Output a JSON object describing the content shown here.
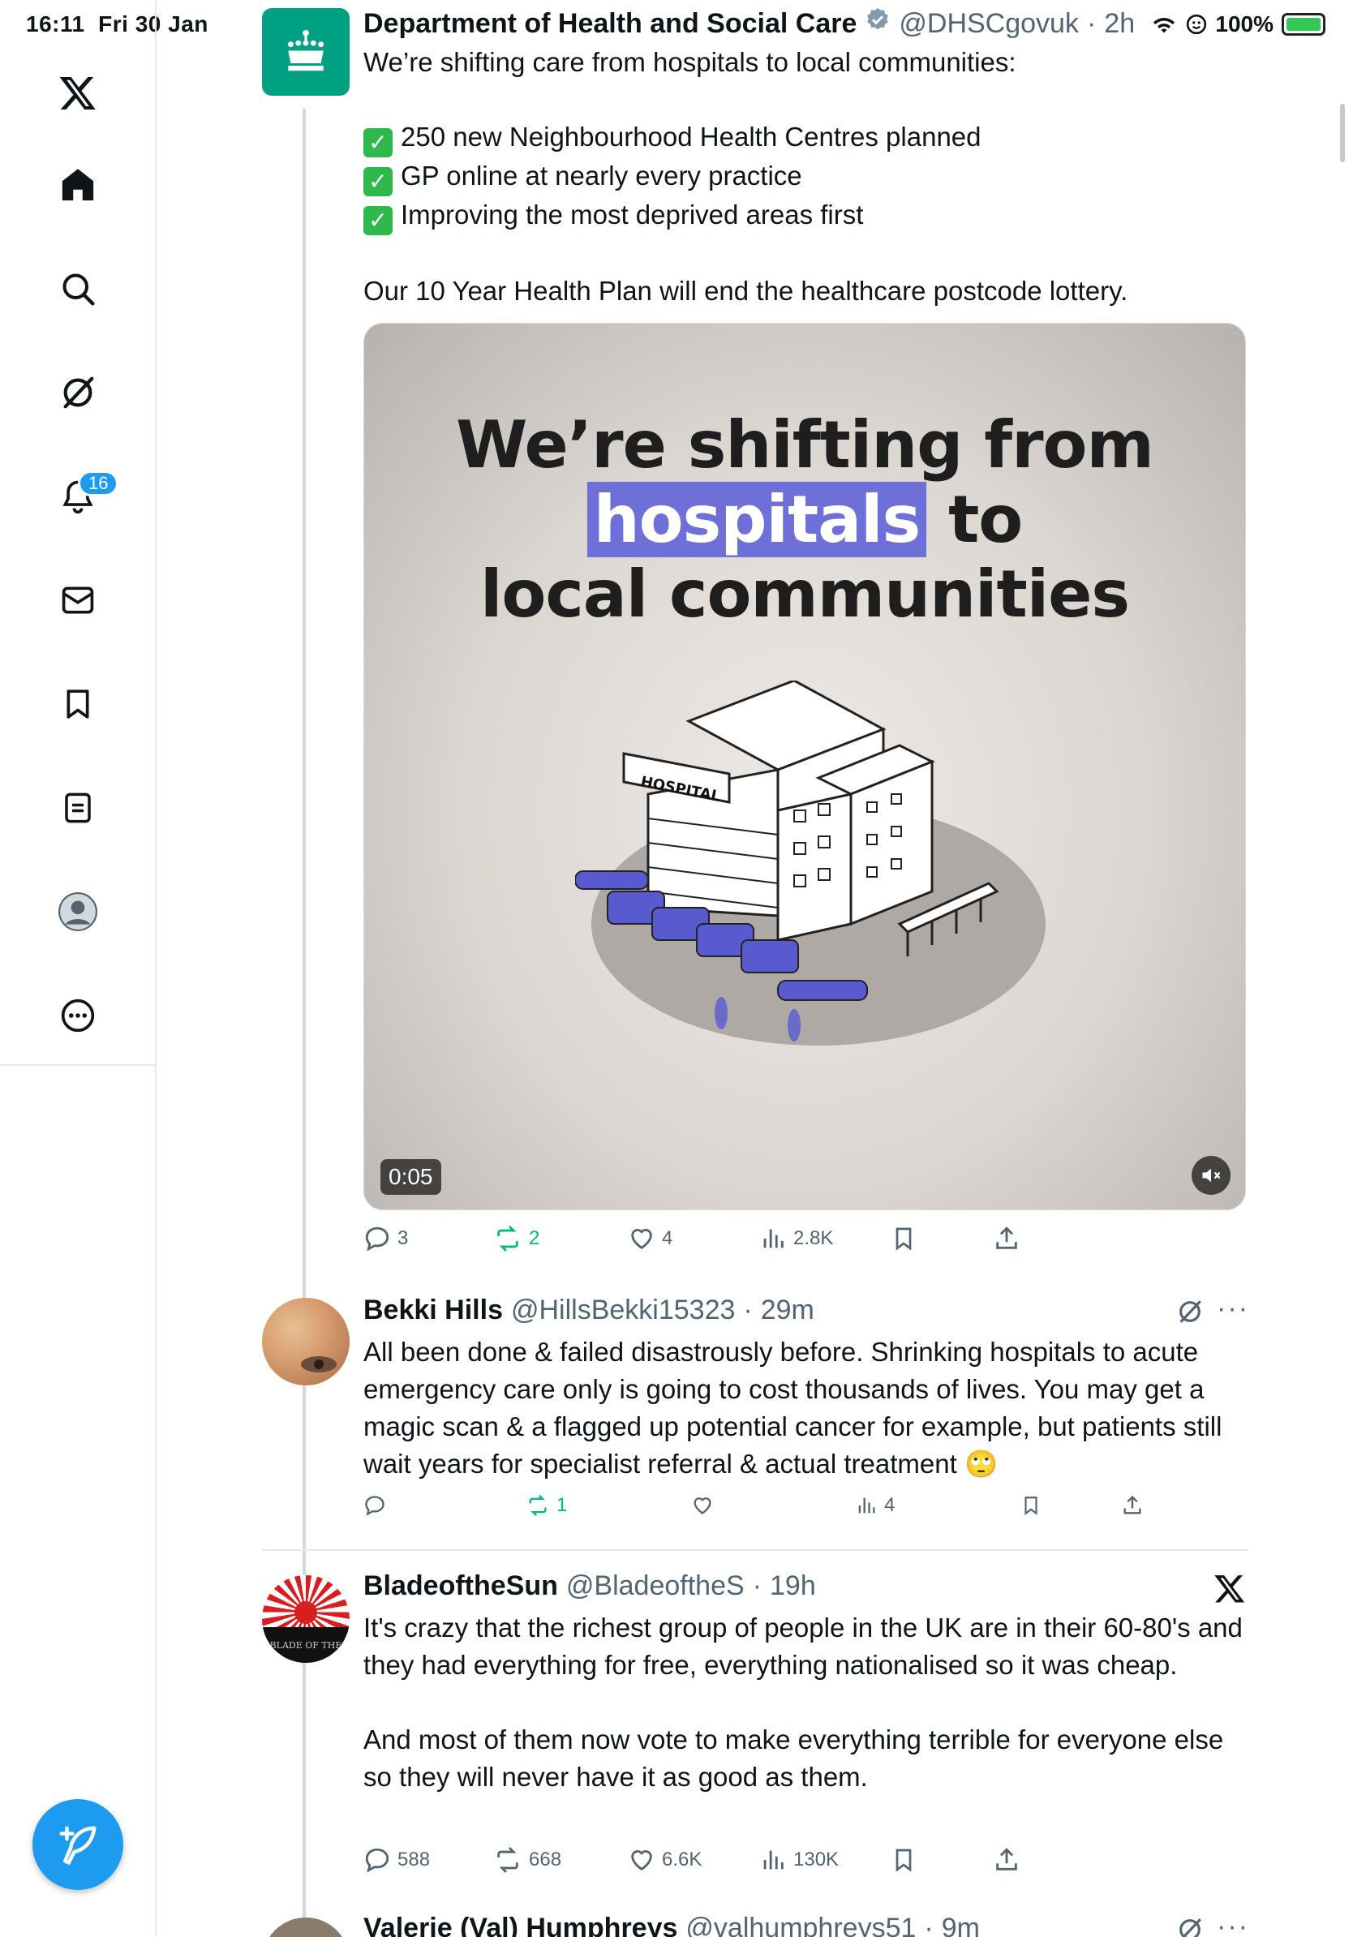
{
  "status": {
    "time": "16:11",
    "date": "Fri 30 Jan",
    "battery": "100%"
  },
  "nav": {
    "notifications_badge": "16"
  },
  "main_tweet": {
    "name": "Department of Health and Social Care",
    "handle": "@DHSCgovuk",
    "time": "2h",
    "intro": "We’re shifting care from hospitals to local communities:",
    "bullets": [
      "250 new Neighbourhood Health Centres planned",
      "GP online at nearly every practice",
      "Improving the most deprived areas first"
    ],
    "outro": "Our 10 Year Health Plan will end the healthcare postcode lottery.",
    "media": {
      "line1": "We’re shifting from",
      "highlight": "hospitals",
      "line2_rest": "to",
      "line3": "local communities",
      "sign": "HOSPITAL",
      "duration": "0:05"
    },
    "stats": {
      "replies": "3",
      "reposts": "2",
      "likes": "4",
      "views": "2.8K"
    }
  },
  "replies": [
    {
      "name": "Bekki Hills",
      "handle": "@HillsBekki15323",
      "time": "29m",
      "text": "All been done & failed disastrously before. Shrinking hospitals to acute emergency care only is going to cost thousands of lives. You may get a magic scan & a flagged up potential cancer for example, but patients still wait years for specialist referral & actual treatment 🙄",
      "stats": {
        "replies": "",
        "reposts": "1",
        "likes": "",
        "views": "4"
      }
    },
    {
      "name": "BladeoftheSun",
      "handle": "@BladeoftheS",
      "time": "19h",
      "avatar_text": "BLADE OF THE",
      "text1": "It's crazy that the richest group of people in the UK are in their 60-80's and they had everything for free, everything nationalised so it was cheap.",
      "text2": "And most of them now vote to make everything terrible for everyone else so they will never have it as good as them.",
      "stats": {
        "replies": "588",
        "reposts": "668",
        "likes": "6.6K",
        "views": "130K"
      }
    },
    {
      "name": "Valerie (Val) Humphreys",
      "handle": "@valhumphreys51",
      "time": "9m"
    }
  ]
}
